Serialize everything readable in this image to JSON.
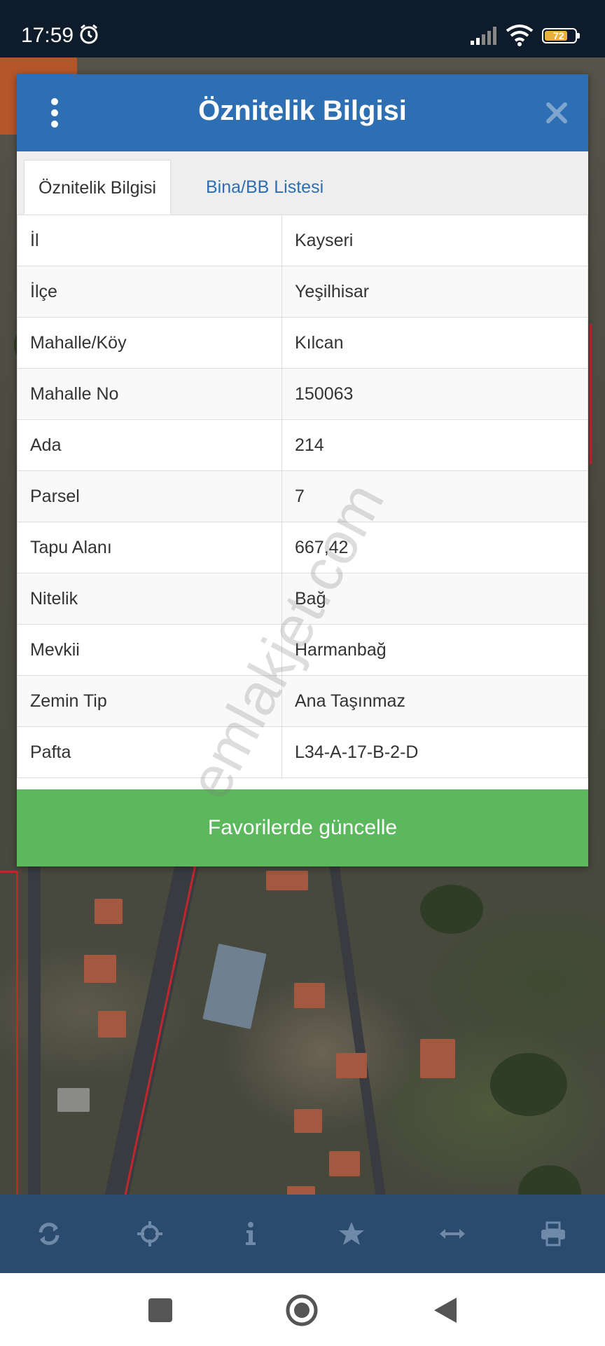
{
  "status_bar": {
    "time": "17:59",
    "battery_level": "72",
    "icons": [
      "alarm-icon",
      "signal-icon",
      "wifi-icon",
      "battery-icon"
    ]
  },
  "dialog": {
    "title": "Öznitelik Bilgisi",
    "tabs": [
      {
        "label": "Öznitelik Bilgisi",
        "active": true
      },
      {
        "label": "Bina/BB Listesi",
        "active": false
      }
    ],
    "rows": [
      {
        "key": "İl",
        "value": "Kayseri"
      },
      {
        "key": "İlçe",
        "value": "Yeşilhisar"
      },
      {
        "key": "Mahalle/Köy",
        "value": "Kılcan"
      },
      {
        "key": "Mahalle No",
        "value": "150063"
      },
      {
        "key": "Ada",
        "value": "214"
      },
      {
        "key": "Parsel",
        "value": "7"
      },
      {
        "key": "Tapu Alanı",
        "value": "667,42"
      },
      {
        "key": "Nitelik",
        "value": "Bağ"
      },
      {
        "key": "Mevkii",
        "value": "Harmanbağ"
      },
      {
        "key": "Zemin Tip",
        "value": "Ana Taşınmaz"
      },
      {
        "key": "Pafta",
        "value": "L34-A-17-B-2-D"
      }
    ],
    "button_label": "Favorilerde güncelle"
  },
  "watermark": "emlakjet.com",
  "toolbar": {
    "icons": [
      "refresh-icon",
      "locate-icon",
      "info-icon",
      "star-icon",
      "measure-icon",
      "print-icon"
    ]
  },
  "colors": {
    "header": "#2e6fb3",
    "button": "#5cb85c",
    "toolbar": "#2a4a6e"
  }
}
